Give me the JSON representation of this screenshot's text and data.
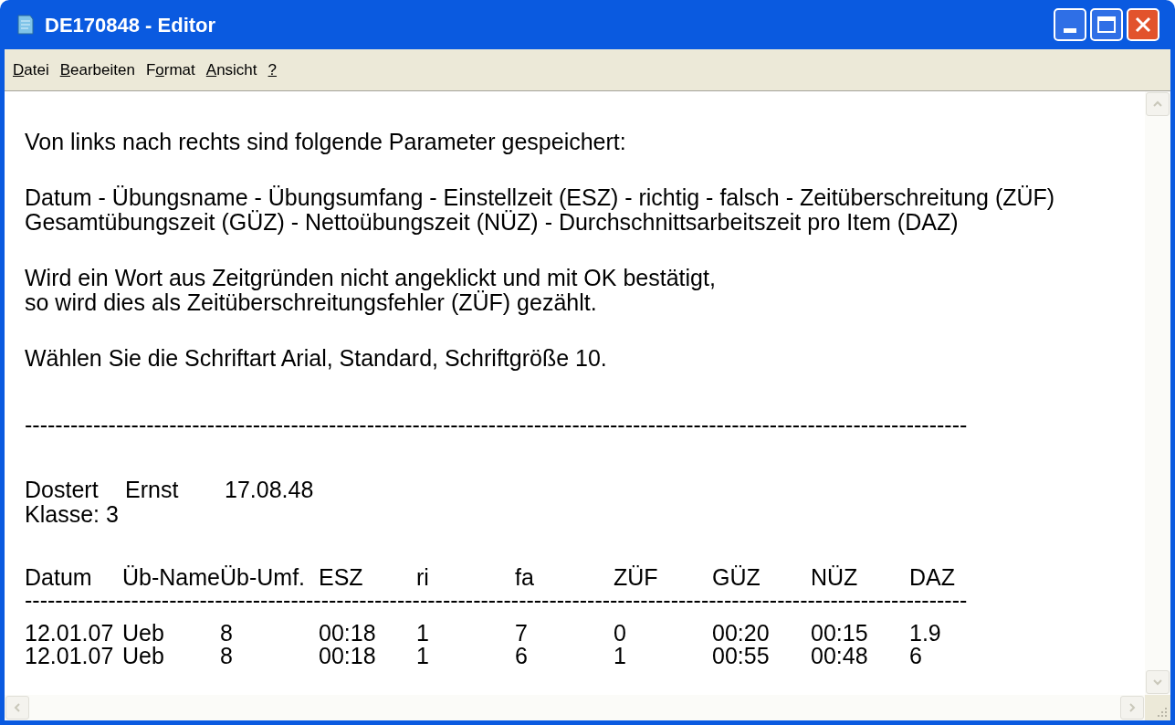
{
  "window": {
    "title": "DE170848 - Editor"
  },
  "menu": [
    {
      "access_key": "D",
      "after": "atei"
    },
    {
      "access_key": "B",
      "after": "earbeiten"
    },
    {
      "before": "F",
      "access_key": "o",
      "after": "rmat"
    },
    {
      "access_key": "A",
      "after": "nsicht"
    },
    {
      "access_key": "?"
    }
  ],
  "document": {
    "paragraphs": [
      [
        "Von links nach rechts sind folgende Parameter gespeichert:"
      ],
      [
        "Datum - Übungsname - Übungsumfang - Einstellzeit (ESZ) - richtig - falsch - Zeitüberschreitung (ZÜF)",
        "Gesamtübungszeit (GÜZ) - Nettoübungszeit (NÜZ) - Durchschnittsarbeitszeit pro Item (DAZ)"
      ],
      [
        "Wird ein Wort aus Zeitgründen nicht angeklickt und mit OK bestätigt,",
        "so wird dies als Zeitüberschreitungsfehler (ZÜF) gezählt."
      ],
      [
        "Wählen Sie die Schriftart Arial, Standard, Schriftgröße 10."
      ],
      [
        "----------------------------------------------------------------------------------------------------------------------------"
      ]
    ],
    "person": {
      "fields": [
        "Dostert",
        "Ernst",
        "17.08.48"
      ],
      "class_line": "Klasse: 3"
    },
    "table": {
      "columns": [
        "Datum",
        "Üb-Name",
        "Üb-Umf.",
        "ESZ",
        "ri",
        "fa",
        "ZÜF",
        "GÜZ",
        "NÜZ",
        "DAZ"
      ],
      "separator": "----------------------------------------------------------------------------------------------------------------------------",
      "rows": [
        [
          "12.01.07",
          "Ueb",
          "8",
          "00:18",
          "1",
          "7",
          "0",
          "00:20",
          "00:15",
          "1.9"
        ],
        [
          "12.01.07",
          "Ueb",
          "8",
          "00:18",
          "1",
          "6",
          "1",
          "00:55",
          "00:48",
          "6"
        ]
      ]
    }
  }
}
